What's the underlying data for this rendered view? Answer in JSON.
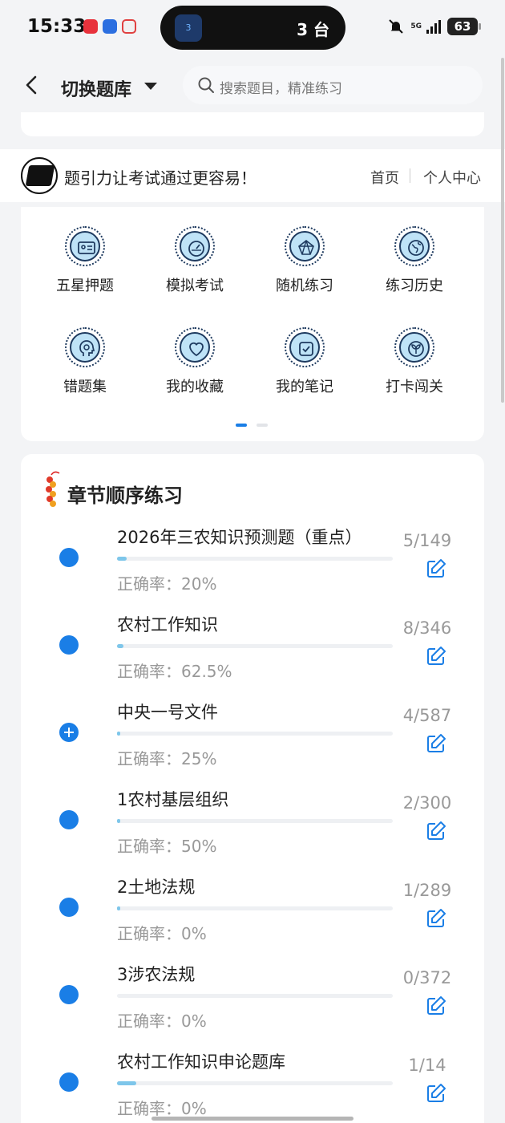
{
  "status_bar": {
    "time": "15:33",
    "island_text": "3 台",
    "island_badge": "3",
    "network": "5G",
    "battery": "63"
  },
  "header": {
    "title": "切换题库",
    "search_placeholder": "搜索题目，精准练习"
  },
  "brand": {
    "slogan": "题引力让考试通过更容易！",
    "nav_home": "首页",
    "nav_me": "个人中心"
  },
  "grid": [
    {
      "label": "五星押题",
      "icon": "id-card-icon"
    },
    {
      "label": "模拟考试",
      "icon": "gauge-icon"
    },
    {
      "label": "随机练习",
      "icon": "network-icon"
    },
    {
      "label": "练习历史",
      "icon": "globe-icon"
    },
    {
      "label": "错题集",
      "icon": "head-icon"
    },
    {
      "label": "我的收藏",
      "icon": "heart-icon"
    },
    {
      "label": "我的笔记",
      "icon": "note-icon"
    },
    {
      "label": "打卡闯关",
      "icon": "leaf-icon"
    }
  ],
  "chapters": {
    "title": "章节顺序练习",
    "items": [
      {
        "name": "2026年三农知识预测题（重点）",
        "rate": "正确率：20%",
        "count": "5/149",
        "progress": 0.034,
        "marker": "dot"
      },
      {
        "name": "农村工作知识",
        "rate": "正确率：62.5%",
        "count": "8/346",
        "progress": 0.023,
        "marker": "dot"
      },
      {
        "name": "中央一号文件",
        "rate": "正确率：25%",
        "count": "4/587",
        "progress": 0.007,
        "marker": "plus"
      },
      {
        "name": "1农村基层组织",
        "rate": "正确率：50%",
        "count": "2/300",
        "progress": 0.007,
        "marker": "dot"
      },
      {
        "name": "2土地法规",
        "rate": "正确率：0%",
        "count": "1/289",
        "progress": 0.003,
        "marker": "dot"
      },
      {
        "name": "3涉农法规",
        "rate": "正确率：0%",
        "count": "0/372",
        "progress": 0.0,
        "marker": "dot"
      },
      {
        "name": "农村工作知识申论题库",
        "rate": "正确率：0%",
        "count": "1/14",
        "progress": 0.071,
        "marker": "dot"
      }
    ]
  },
  "colors": {
    "accent": "#1a7ee6",
    "progress_fill": "#7ec6ea",
    "icon_bg": "#bfe3f7",
    "icon_stroke": "#1e3a5f"
  }
}
